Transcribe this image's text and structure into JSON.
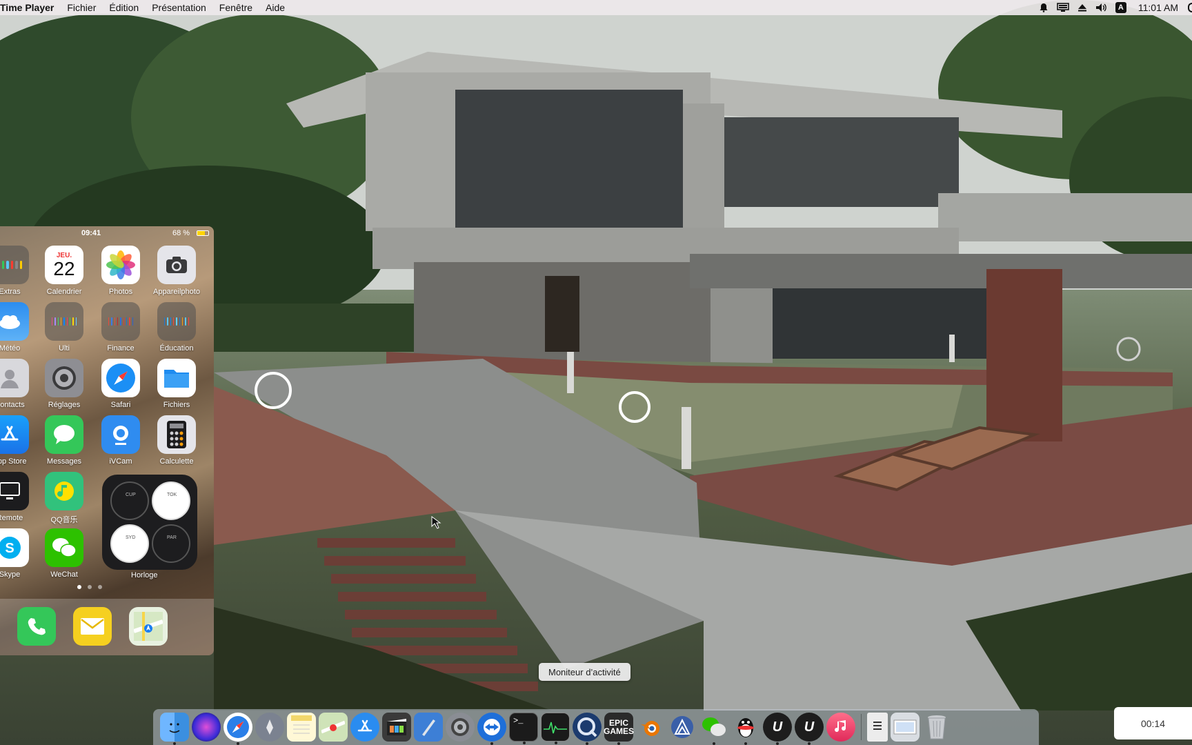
{
  "menubar": {
    "app_name": "Time Player",
    "menus": [
      "Fichier",
      "Édition",
      "Présentation",
      "Fenêtre",
      "Aide"
    ],
    "status_icons": [
      "notification-bell-icon",
      "display-icon",
      "eject-icon",
      "volume-icon",
      "input-source-icon"
    ],
    "input_source_label": "A",
    "clock": "11:01 AM"
  },
  "phone": {
    "status_time": "09:41",
    "battery": "68 %",
    "battery_level": 0.68,
    "calendar": {
      "weekday": "JEU.",
      "day": "22"
    },
    "apps": [
      {
        "label": "Extras",
        "icon": "folder-icon"
      },
      {
        "label": "Calendrier",
        "icon": "calendar-icon"
      },
      {
        "label": "Photos",
        "icon": "photos-icon"
      },
      {
        "label": "Appareilphoto",
        "icon": "camera-icon"
      },
      {
        "label": "Météo",
        "icon": "weather-icon"
      },
      {
        "label": "Ulti",
        "icon": "folder-icon"
      },
      {
        "label": "Finance",
        "icon": "folder-icon"
      },
      {
        "label": "Éducation",
        "icon": "folder-icon"
      },
      {
        "label": "Contacts",
        "icon": "contacts-icon"
      },
      {
        "label": "Réglages",
        "icon": "settings-icon"
      },
      {
        "label": "Safari",
        "icon": "safari-icon"
      },
      {
        "label": "Fichiers",
        "icon": "files-icon"
      },
      {
        "label": "App Store",
        "icon": "app-store-icon"
      },
      {
        "label": "Messages",
        "icon": "messages-icon"
      },
      {
        "label": "iVCam",
        "icon": "ivcam-icon"
      },
      {
        "label": "Calculette",
        "icon": "calculator-icon"
      },
      {
        "label": "Remote",
        "icon": "remote-icon"
      },
      {
        "label": "QQ音乐",
        "icon": "qq-music-icon"
      },
      {
        "label": "Skype",
        "icon": "skype-icon"
      },
      {
        "label": "WeChat",
        "icon": "wechat-icon"
      }
    ],
    "clock_widget_label": "Horloge",
    "clock_cities": [
      "CUP",
      "TOK",
      "SYD",
      "PAR"
    ],
    "dock_apps": [
      "phone-icon",
      "mail-icon",
      "maps-icon"
    ]
  },
  "tooltip": "Moniteur d’activité",
  "dock": {
    "items": [
      {
        "name": "finder",
        "color": "#3b8fe0",
        "running": true
      },
      {
        "name": "siri",
        "color": "#6b4fd8",
        "running": false
      },
      {
        "name": "safari",
        "color": "#2a7fe8",
        "running": true
      },
      {
        "name": "launchpad",
        "color": "#7b8290",
        "running": false
      },
      {
        "name": "notes",
        "color": "#f2d76b",
        "running": false
      },
      {
        "name": "maps",
        "color": "#8bc47a",
        "running": false
      },
      {
        "name": "app-store",
        "color": "#2a8cf0",
        "running": false
      },
      {
        "name": "final-cut",
        "color": "#3a3a3a",
        "running": false
      },
      {
        "name": "xcode",
        "color": "#3d7fd6",
        "running": false
      },
      {
        "name": "system-preferences",
        "color": "#8a8d94",
        "running": false
      },
      {
        "name": "teamviewer",
        "color": "#1e6fd9",
        "running": true
      },
      {
        "name": "terminal",
        "color": "#1b1b1b",
        "running": true
      },
      {
        "name": "activity-monitor",
        "color": "#1a1a1a",
        "running": true
      },
      {
        "name": "quicktime",
        "color": "#1c3b6e",
        "running": true
      },
      {
        "name": "epic-games",
        "color": "#2a2a2a",
        "running": true
      },
      {
        "name": "blender",
        "color": "#ea7600",
        "running": false
      },
      {
        "name": "affinity",
        "color": "#3a5fa8",
        "running": false
      },
      {
        "name": "wechat",
        "color": "#2dc100",
        "running": true
      },
      {
        "name": "qq",
        "color": "#111111",
        "running": true
      },
      {
        "name": "unreal-engine",
        "color": "#1d1d1d",
        "running": true
      },
      {
        "name": "unreal-engine-2",
        "color": "#1d1d1d",
        "running": true
      },
      {
        "name": "music",
        "color": "#f0456a",
        "running": false
      }
    ],
    "epic_label": "EPIC\nGAMES",
    "right_items": [
      {
        "name": "document",
        "color": "#ececec"
      },
      {
        "name": "preview",
        "color": "#d9dde2"
      },
      {
        "name": "trash",
        "color": "#c9ccd0"
      }
    ]
  },
  "timer": "00:14"
}
